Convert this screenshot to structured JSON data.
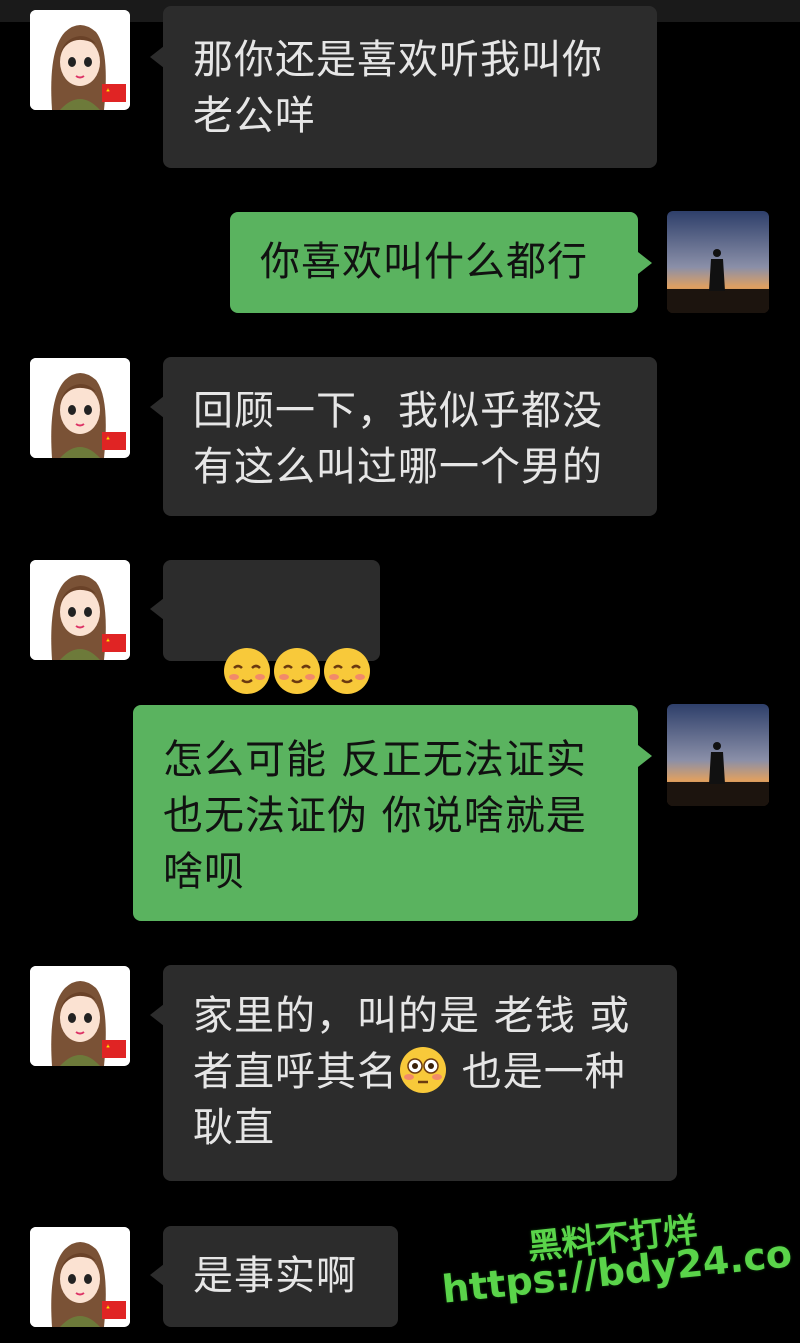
{
  "messages": [
    {
      "side": "left",
      "text": "那你还是喜欢听我叫你\n老公咩"
    },
    {
      "side": "right",
      "text": "你喜欢叫什么都行"
    },
    {
      "side": "left",
      "text": "回顾一下，我似乎都没\n有这么叫过哪一个男的"
    },
    {
      "side": "left",
      "text": "",
      "emoji": [
        "blush-emoji",
        "blush-emoji",
        "blush-emoji"
      ]
    },
    {
      "side": "right",
      "text": "怎么可能 反正无法证实\n也无法证伪 你说啥就是\n啥呗"
    },
    {
      "side": "left",
      "text_before": "家里的，叫的是 老钱 或\n者直呼其名",
      "emoji_inline": "flushed-emoji",
      "text_after": " 也是一种\n耿直"
    },
    {
      "side": "left",
      "text": "是事实啊"
    }
  ],
  "watermark": {
    "line1": "黑料不打烊",
    "line2": "https://bdy24.co"
  },
  "colors": {
    "background": "#000000",
    "left_bubble": "#2c2c2c",
    "right_bubble": "#5ab35f",
    "watermark": "#5ad44a"
  }
}
